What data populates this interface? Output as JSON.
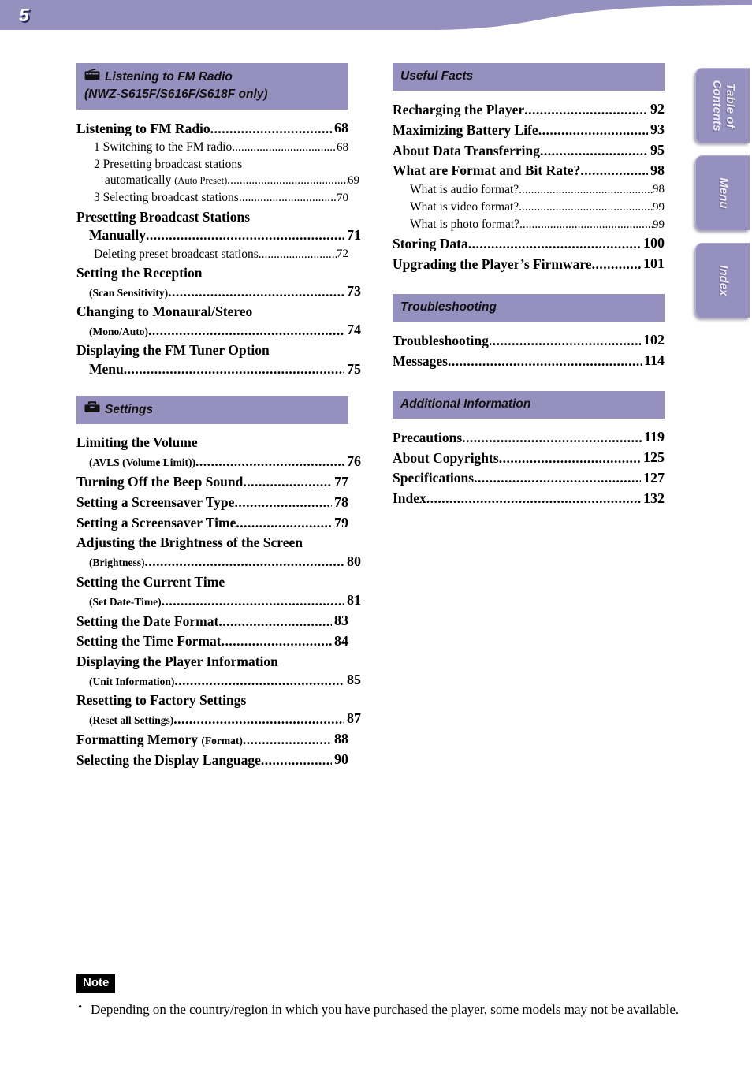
{
  "page": {
    "number": "5",
    "banner_color": "#9690be"
  },
  "side_tabs": [
    {
      "label": "Table of\nContents",
      "line1": "Table of",
      "line2": "Contents"
    },
    {
      "label": "Menu",
      "line1": "Menu",
      "line2": ""
    },
    {
      "label": "Index",
      "line1": "Index",
      "line2": ""
    }
  ],
  "left_column": [
    {
      "heading": {
        "line1": "Listening to FM Radio",
        "line2": "(NWZ-S615F/S616F/S618F only)",
        "icon": "radio-icon"
      },
      "entries": [
        {
          "level": 1,
          "title": "Listening to FM Radio",
          "sub": "",
          "page": "68"
        },
        {
          "level": 2,
          "title": "1 Switching to the FM radio",
          "sub": "",
          "page": "68"
        },
        {
          "level": 2,
          "title": "2 Presetting broadcast stations",
          "title2": "automatically",
          "sub": "(Auto Preset)",
          "page": "69"
        },
        {
          "level": 2,
          "title": "3 Selecting broadcast stations",
          "sub": "",
          "page": "70"
        },
        {
          "level": 1,
          "title": "Presetting Broadcast Stations",
          "title2": "Manually",
          "sub": "",
          "page": "71"
        },
        {
          "level": 2,
          "title": "Deleting preset broadcast stations",
          "sub": "",
          "page": "72"
        },
        {
          "level": 1,
          "title": "Setting the Reception",
          "title2": "",
          "sub": "(Scan Sensitivity)",
          "page": "73"
        },
        {
          "level": 1,
          "title": "Changing to Monaural/Stereo",
          "title2": "",
          "sub": "(Mono/Auto)",
          "page": "74"
        },
        {
          "level": 1,
          "title": "Displaying the FM Tuner Option",
          "title2": "Menu",
          "sub": "",
          "page": "75"
        }
      ]
    },
    {
      "heading": {
        "line1": "Settings",
        "line2": "",
        "icon": "toolbox-icon"
      },
      "entries": [
        {
          "level": 1,
          "title": "Limiting the Volume",
          "title2": "",
          "sub": "(AVLS (Volume Limit))",
          "page": "76"
        },
        {
          "level": 1,
          "title": "Turning Off the Beep Sound",
          "sub": "",
          "page": "77"
        },
        {
          "level": 1,
          "title": "Setting a Screensaver Type",
          "sub": "",
          "page": "78"
        },
        {
          "level": 1,
          "title": "Setting a Screensaver Time",
          "sub": "",
          "page": "79"
        },
        {
          "level": 1,
          "title": "Adjusting the Brightness of the Screen",
          "title2": "",
          "sub": "(Brightness)",
          "page": "80"
        },
        {
          "level": 1,
          "title": "Setting the Current Time",
          "title2": "",
          "sub": "(Set Date-Time)",
          "page": "81"
        },
        {
          "level": 1,
          "title": "Setting the Date Format",
          "sub": "",
          "page": "83"
        },
        {
          "level": 1,
          "title": "Setting the Time Format",
          "sub": "",
          "page": "84"
        },
        {
          "level": 1,
          "title": "Displaying the Player Information",
          "title2": "",
          "sub": "(Unit Information)",
          "page": "85"
        },
        {
          "level": 1,
          "title": "Resetting to Factory Settings",
          "title2": "",
          "sub": "(Reset all Settings)",
          "page": "87"
        },
        {
          "level": 1,
          "title": "Formatting Memory",
          "sub": "(Format)",
          "inline_sub": true,
          "page": "88"
        },
        {
          "level": 1,
          "title": "Selecting the Display Language",
          "sub": "",
          "page": "90"
        }
      ]
    }
  ],
  "right_column": [
    {
      "heading": {
        "line1": "Useful Facts",
        "line2": "",
        "icon": ""
      },
      "entries": [
        {
          "level": 1,
          "title": "Recharging the Player",
          "sub": "",
          "page": "92"
        },
        {
          "level": 1,
          "title": "Maximizing Battery Life",
          "sub": "",
          "page": "93"
        },
        {
          "level": 1,
          "title": "About Data Transferring",
          "sub": "",
          "page": "95"
        },
        {
          "level": 1,
          "title": "What are Format and Bit Rate?",
          "sub": "",
          "page": "98"
        },
        {
          "level": 2,
          "title": "What is audio format?",
          "sub": "",
          "page": "98"
        },
        {
          "level": 2,
          "title": "What is video format?",
          "sub": "",
          "page": "99"
        },
        {
          "level": 2,
          "title": "What is photo format?",
          "sub": "",
          "page": "99"
        },
        {
          "level": 1,
          "title": "Storing Data",
          "sub": "",
          "page": "100"
        },
        {
          "level": 1,
          "title": "Upgrading the Player’s Firmware",
          "sub": "",
          "page": "101"
        }
      ]
    },
    {
      "heading": {
        "line1": "Troubleshooting",
        "line2": "",
        "icon": ""
      },
      "entries": [
        {
          "level": 1,
          "title": "Troubleshooting",
          "sub": "",
          "page": "102"
        },
        {
          "level": 1,
          "title": "Messages",
          "sub": "",
          "page": "114"
        }
      ]
    },
    {
      "heading": {
        "line1": "Additional Information",
        "line2": "",
        "icon": ""
      },
      "entries": [
        {
          "level": 1,
          "title": "Precautions",
          "sub": "",
          "page": "119"
        },
        {
          "level": 1,
          "title": "About Copyrights",
          "sub": "",
          "page": "125"
        },
        {
          "level": 1,
          "title": "Specifications",
          "sub": "",
          "page": "127"
        },
        {
          "level": 1,
          "title": "Index",
          "sub": "",
          "page": "132"
        }
      ]
    }
  ],
  "note": {
    "badge": "Note",
    "items": [
      "Depending on the country/region in which you have purchased the player, some models may not be available."
    ]
  }
}
